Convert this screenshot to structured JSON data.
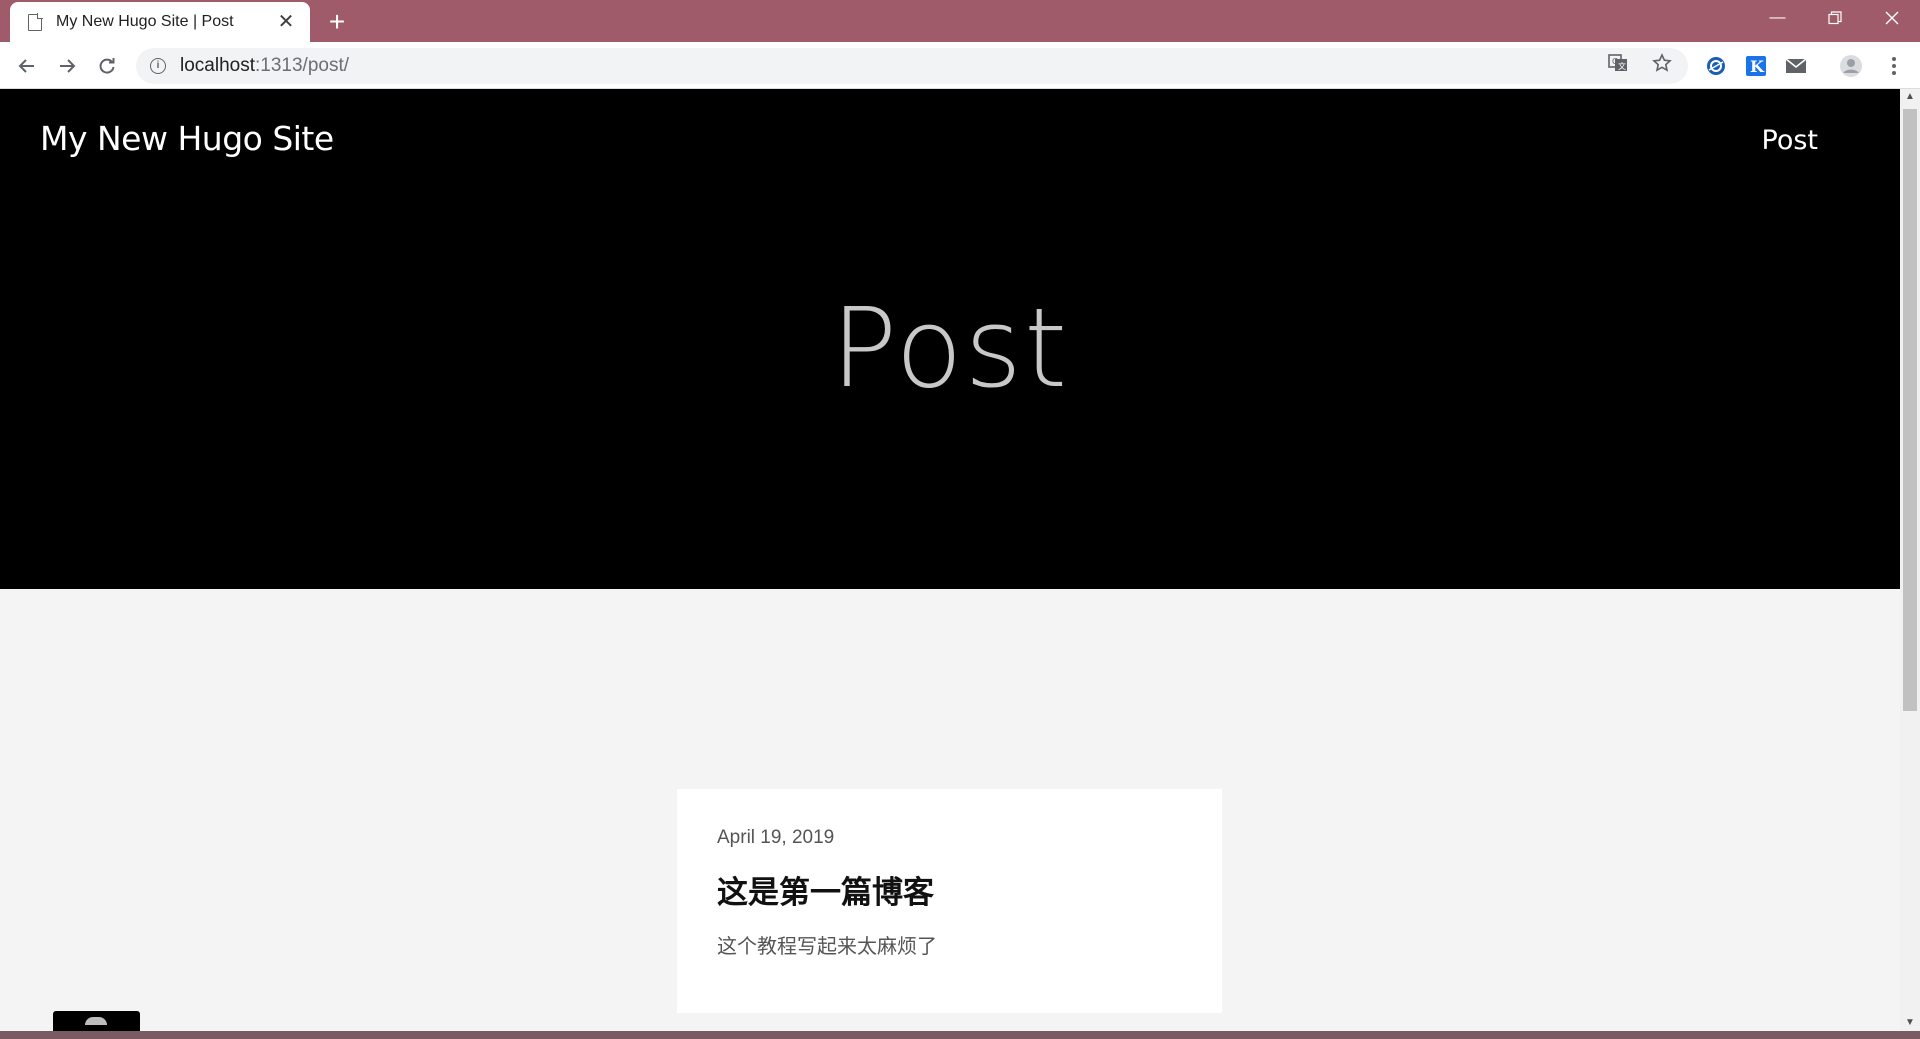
{
  "browser": {
    "tab_title": "My New Hugo Site | Post",
    "url_host": "localhost",
    "url_rest": ":1313/post/"
  },
  "icons": {
    "back": "arrow-left",
    "forward": "arrow-right",
    "reload": "reload",
    "info": "info",
    "translate": "translate",
    "bookmark": "star",
    "ext_bing": "bing-extension",
    "ext_k": "k-extension",
    "ext_mail": "mail-extension",
    "profile": "avatar",
    "menu": "kebab-menu"
  },
  "site": {
    "title": "My New Hugo Site",
    "nav_post": "Post",
    "hero_heading": "Post"
  },
  "posts": [
    {
      "date": "April 19, 2019",
      "title": "这是第一篇博客",
      "summary": "这个教程写起来太麻烦了"
    }
  ],
  "colors": {
    "titlebar": "#a05b6a",
    "hero_bg": "#000000",
    "page_bg": "#f4f4f4",
    "ext_k": "#1a73e8"
  }
}
